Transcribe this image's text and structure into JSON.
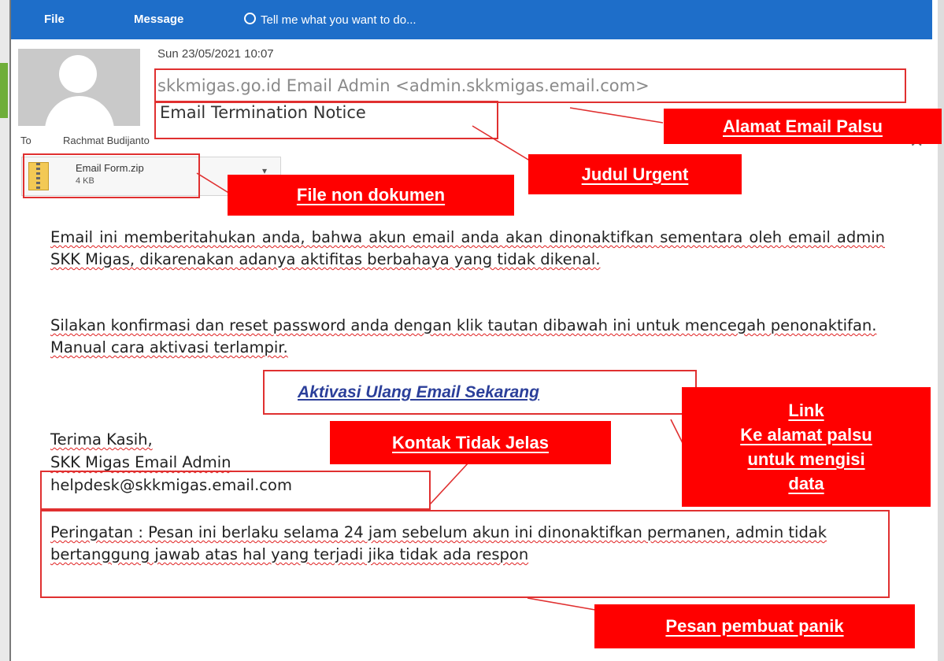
{
  "ribbon": {
    "file": "File",
    "message": "Message",
    "tell": "Tell me what you want to do..."
  },
  "email": {
    "date": "Sun 23/05/2021 10:07",
    "from": "skkmigas.go.id Email Admin <admin.skkmigas.email.com>",
    "subject": "Email Termination Notice",
    "to_label": "To",
    "to_name": "Rachmat Budijanto",
    "attachment": {
      "name": "Email Form.zip",
      "size": "4 KB"
    },
    "body": {
      "paragraph1": "Email ini memberitahukan anda, bahwa akun email anda akan dinonaktifkan sementara oleh email admin SKK Migas, dikarenakan adanya aktifitas berbahaya yang tidak dikenal.",
      "paragraph2": "Silakan konfirmasi dan reset password anda dengan klik tautan dibawah ini untuk mencegah penonaktifan. Manual cara aktivasi terlampir.",
      "link": "Aktivasi Ulang Email Sekarang",
      "closing": "Terima Kasih,",
      "signature": "SKK Migas Email Admin",
      "contact": "helpdesk@skkmigas.email.com",
      "warning": "Peringatan : Pesan ini berlaku selama 24 jam sebelum akun ini dinonaktifkan permanen, admin tidak bertanggung jawab atas hal yang terjadi jika tidak ada respon"
    }
  },
  "callouts": {
    "fake_address": "Alamat Email Palsu",
    "urgent_subject": "Judul Urgent",
    "non_document": "File non dokumen",
    "link_lines": [
      "Link",
      "Ke alamat palsu",
      "untuk mengisi",
      "data"
    ],
    "unclear_contact": "Kontak Tidak Jelas",
    "panic_message": "Pesan pembuat panik"
  },
  "colors": {
    "ribbon": "#1e6ec9",
    "callout": "#ff0000",
    "box": "#e03030",
    "link": "#2b3f9a"
  },
  "icons": {
    "bulb": "lightbulb-icon",
    "avatar": "user-avatar-icon",
    "zip": "zip-file-icon",
    "close": "close-icon",
    "caret": "chevron-down-icon"
  }
}
